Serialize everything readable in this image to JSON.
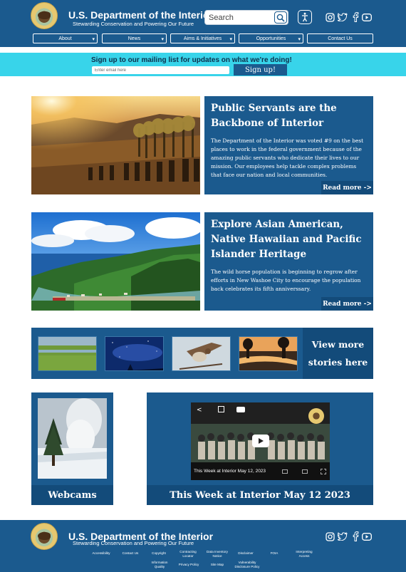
{
  "header": {
    "title": "U.S. Department of the Interior",
    "subtitle": "Stewarding Conservation and Powering Our Future",
    "search_placeholder": "Search"
  },
  "nav": [
    {
      "label": "About"
    },
    {
      "label": "News"
    },
    {
      "label": "Aims & Initiatives"
    },
    {
      "label": "Opportunities"
    },
    {
      "label": "Contact Us"
    }
  ],
  "mailing": {
    "text": "Sign up to our mailing list for updates on what we're doing!",
    "placeholder": "Enter email here",
    "button": "Sign up!"
  },
  "features": [
    {
      "title": "Public Servants are the Backbone of Interior",
      "body": "The Department of the Interior was voted #9 on the best places to work in the federal government because of the amazing public servants who dedicate their lives to our mission. Our employees help tackle complex problems that face our nation and local communities.",
      "link": "Read more ->"
    },
    {
      "title": "Explore Asian American, Native Hawaiian and Pacific Islander Heritage",
      "body": "The wild horse population is beginning to regrow after efforts in New Washoe City to encourage the population back celebrates its fifth anniverssary.",
      "link": "Read more ->"
    }
  ],
  "stories": {
    "view_more": "View more stories here"
  },
  "webcams": {
    "label": "Webcams"
  },
  "video": {
    "label": "This Week at Interior May 12 2023",
    "caption": "This Week at Interior May 12, 2023"
  },
  "footer": {
    "title": "U.S. Department of the Interior",
    "subtitle": "Stewarding Conservation and Powering Our Future",
    "links": [
      "Accessibility",
      "Contact Us",
      "Copyright",
      "Contracting Locator",
      "Data Inventory Notice",
      "Disclaimer",
      "FOIA",
      "Interpreting Access",
      "Information Quality",
      "Privacy Policy",
      "Site Map",
      "Vulnerability Disclosure Policy"
    ]
  }
}
